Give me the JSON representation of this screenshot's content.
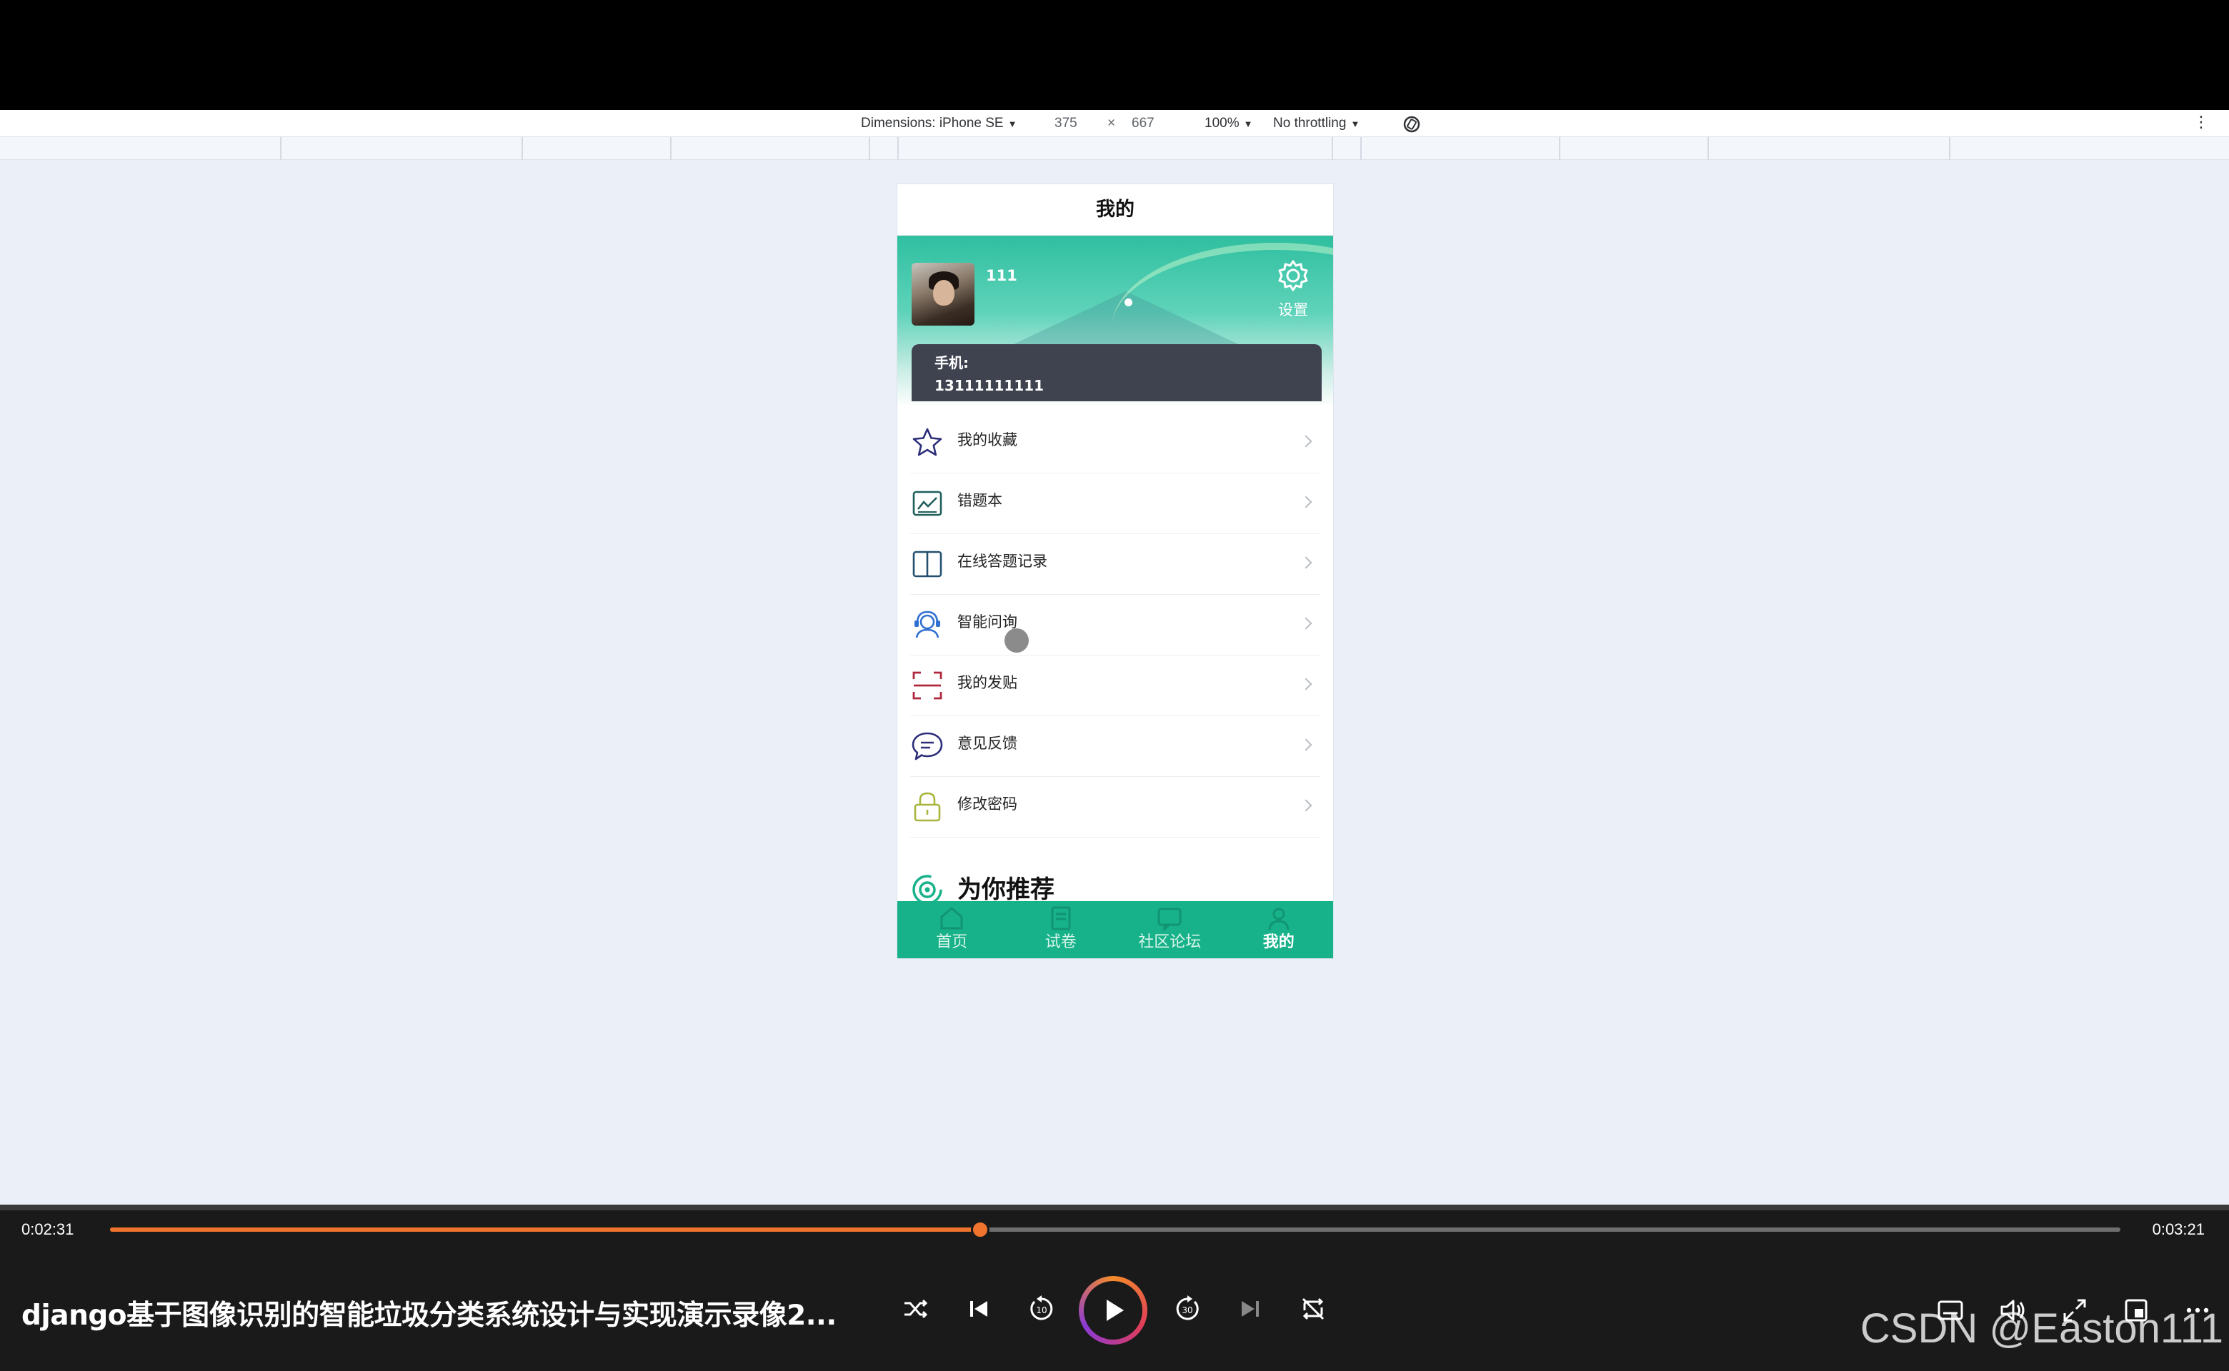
{
  "devtools": {
    "dimensions_label": "Dimensions: iPhone SE",
    "width": "375",
    "times": "×",
    "height": "667",
    "zoom": "100%",
    "throttling": "No throttling",
    "more_icon": "⋮"
  },
  "app": {
    "title": "我的",
    "profile": {
      "username": "111",
      "settings_label": "设置",
      "phone_label": "手机:",
      "phone_value": "13111111111"
    },
    "menu": [
      {
        "label": "我的收藏",
        "icon": "star-icon",
        "color": "#2c2e7a"
      },
      {
        "label": "错题本",
        "icon": "chart-icon",
        "color": "#1f5f5b"
      },
      {
        "label": "在线答题记录",
        "icon": "book-icon",
        "color": "#24506e"
      },
      {
        "label": "智能问询",
        "icon": "support-agent-icon",
        "color": "#2f6fd0"
      },
      {
        "label": "我的发贴",
        "icon": "scan-icon",
        "color": "#b0283d"
      },
      {
        "label": "意见反馈",
        "icon": "chat-bubble-icon",
        "color": "#2c2e7a"
      },
      {
        "label": "修改密码",
        "icon": "lock-icon",
        "color": "#a8b43a"
      }
    ],
    "recommend_title": "为你推荐",
    "tabs": [
      {
        "label": "首页",
        "icon": "home-icon"
      },
      {
        "label": "试卷",
        "icon": "paper-icon"
      },
      {
        "label": "社区论坛",
        "icon": "forum-icon"
      },
      {
        "label": "我的",
        "icon": "user-icon",
        "active": true
      }
    ],
    "accent": "#17b289"
  },
  "player": {
    "current_time": "0:02:31",
    "total_time": "0:03:21",
    "progress": 0.433,
    "title": "django基于图像识别的智能垃圾分类系统设计与实现演示录像2...",
    "rewind_label": "10",
    "forward_label": "30",
    "accent": "#f0742e",
    "watermark": "CSDN @Easton111"
  }
}
